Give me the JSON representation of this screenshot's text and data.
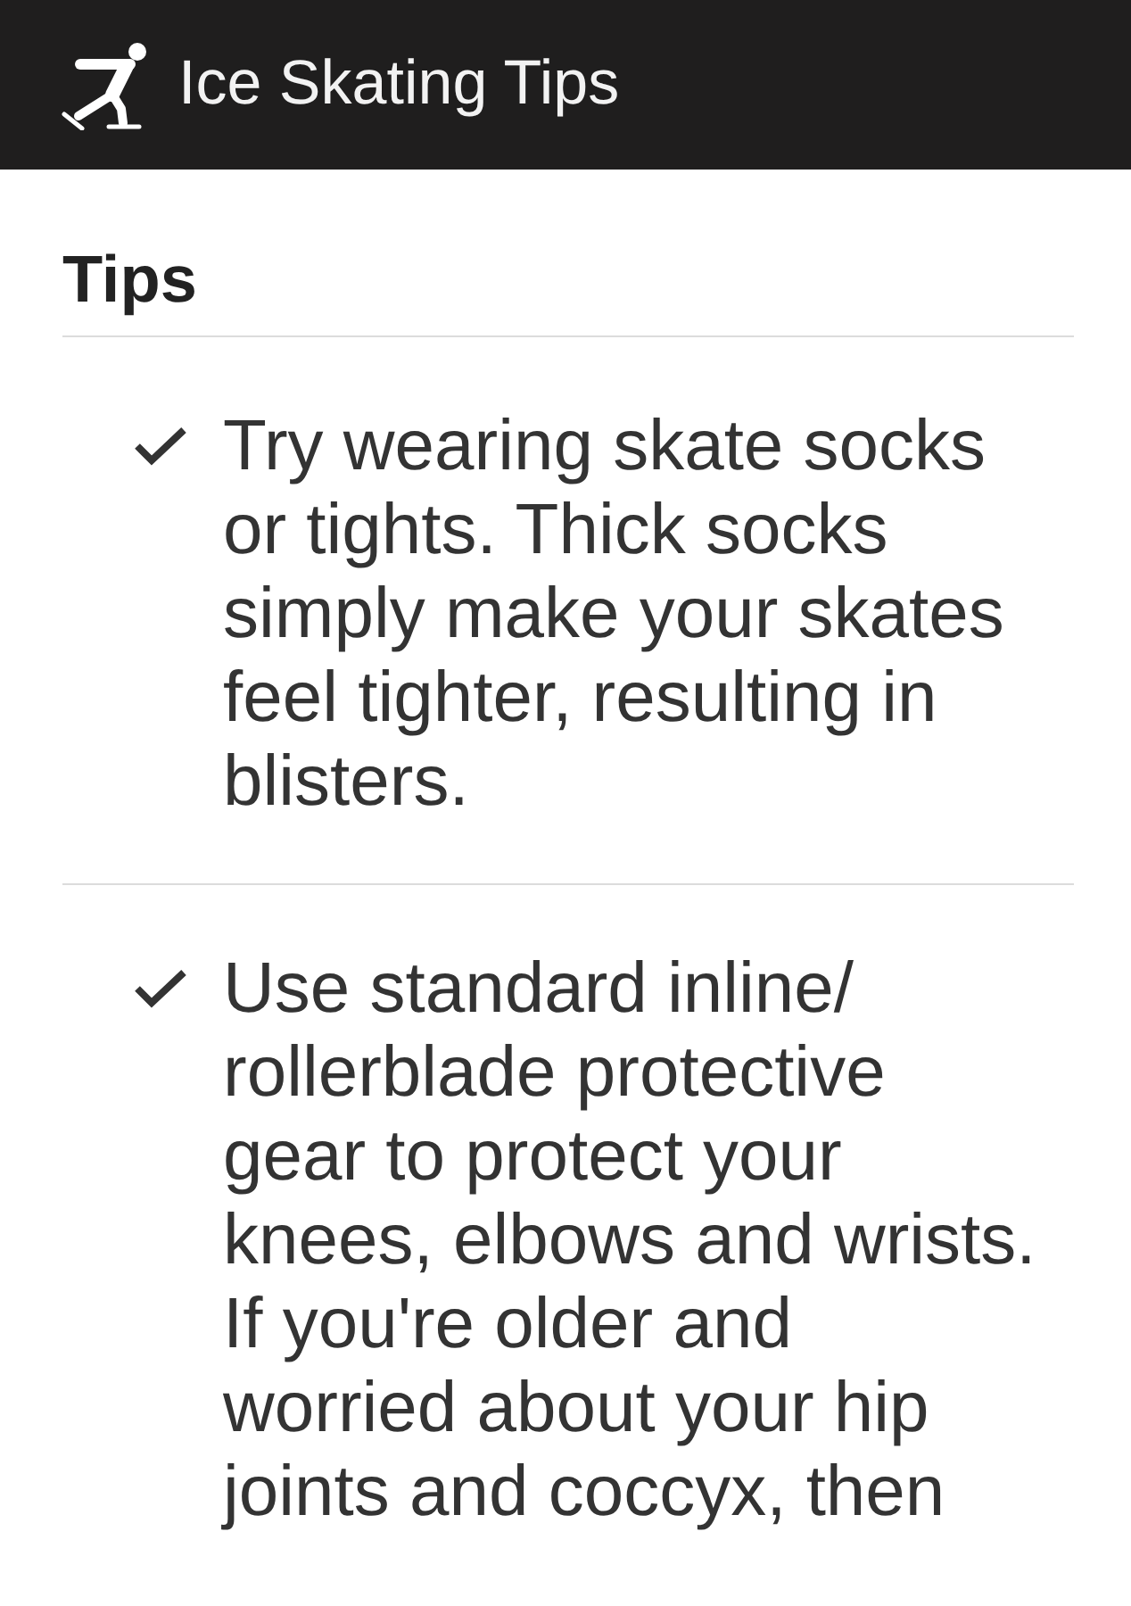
{
  "app_bar": {
    "title": "Ice Skating Tips"
  },
  "section": {
    "heading": "Tips"
  },
  "tips": [
    {
      "text": "Try wearing skate socks or tights. Thick socks simply make your skates feel tighter, resulting in blisters."
    },
    {
      "text": "Use standard inline/rollerblade protective gear to protect your knees, elbows and wrists. If you're older and worried about your hip joints and coccyx, then"
    }
  ]
}
